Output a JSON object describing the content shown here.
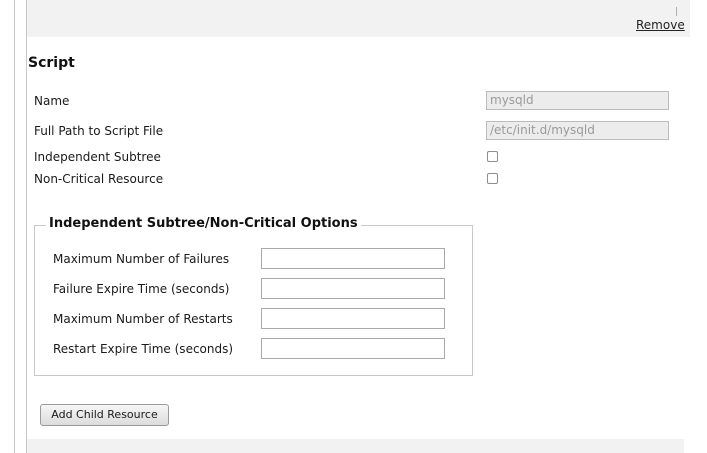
{
  "header": {
    "remove_link": "Remove"
  },
  "script_section": {
    "title": "Script",
    "fields": {
      "name": {
        "label": "Name",
        "value": "mysqld"
      },
      "path": {
        "label": "Full Path to Script File",
        "value": "/etc/init.d/mysqld"
      },
      "independent_subtree": {
        "label": "Independent Subtree",
        "checked": false
      },
      "non_critical": {
        "label": "Non-Critical Resource",
        "checked": false
      }
    }
  },
  "options": {
    "legend": "Independent Subtree/Non-Critical Options",
    "max_failures": {
      "label": "Maximum Number of Failures",
      "value": ""
    },
    "failure_expire": {
      "label": "Failure Expire Time (seconds)",
      "value": ""
    },
    "max_restarts": {
      "label": "Maximum Number of Restarts",
      "value": ""
    },
    "restart_expire": {
      "label": "Restart Expire Time (seconds)",
      "value": ""
    }
  },
  "actions": {
    "add_child_resource": "Add Child Resource"
  }
}
